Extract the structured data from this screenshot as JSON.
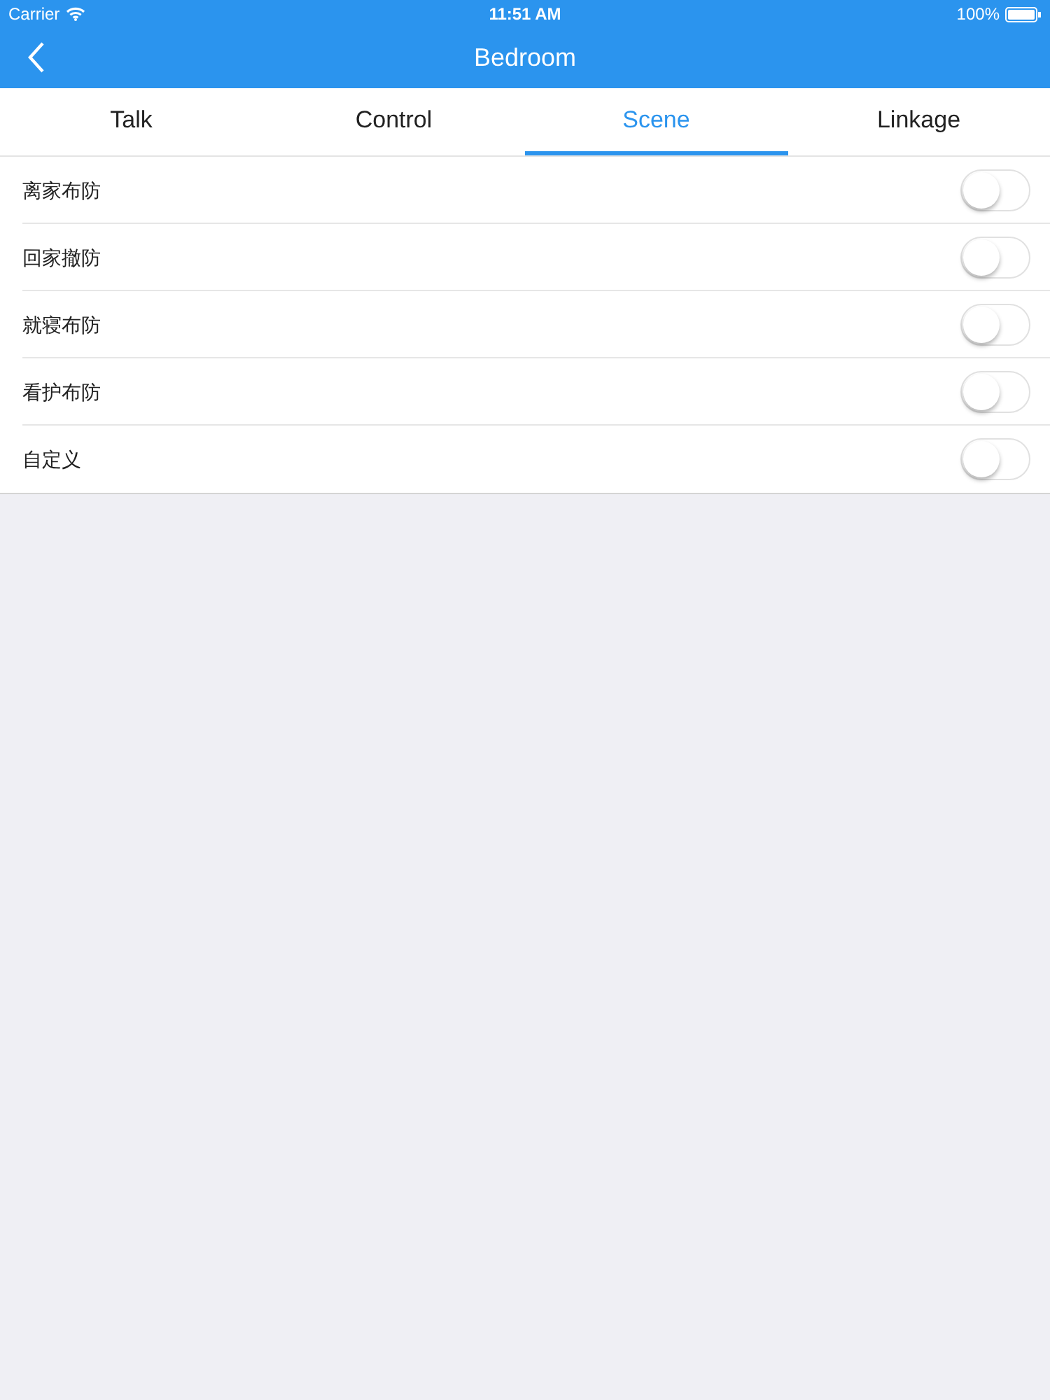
{
  "status_bar": {
    "carrier": "Carrier",
    "time": "11:51 AM",
    "battery": "100%"
  },
  "nav_bar": {
    "title": "Bedroom"
  },
  "tabs": [
    {
      "label": "Talk",
      "selected": false
    },
    {
      "label": "Control",
      "selected": false
    },
    {
      "label": "Scene",
      "selected": true
    },
    {
      "label": "Linkage",
      "selected": false
    }
  ],
  "scenes": [
    {
      "label": "离家布防",
      "on": false
    },
    {
      "label": "回家撤防",
      "on": false
    },
    {
      "label": "就寝布防",
      "on": false
    },
    {
      "label": "看护布防",
      "on": false
    },
    {
      "label": "自定义",
      "on": false
    }
  ]
}
